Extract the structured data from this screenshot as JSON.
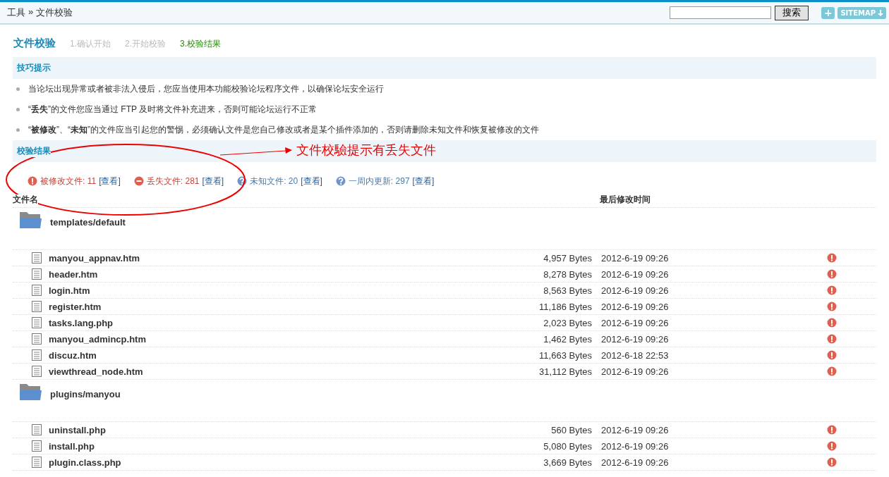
{
  "header": {
    "breadcrumb": [
      "工具",
      "»",
      "文件校验"
    ],
    "search_button": "搜索",
    "plus_button": "+",
    "sitemap_button": "SITEMAP"
  },
  "title": "文件校验",
  "steps": [
    {
      "label": "1.确认开始",
      "selected": false
    },
    {
      "label": "2.开始校验",
      "selected": false
    },
    {
      "label": "3.校验结果",
      "selected": true
    }
  ],
  "tips_heading": "技巧提示",
  "tips": [
    "当论坛出现异常或者被非法入侵后，您应当使用本功能校验论坛程序文件，以确保论坛安全运行",
    "“**丢失**”的文件您应当通过 FTP 及时将文件补充进来，否则可能论坛运行不正常",
    "“**被修改**”、“**未知**”的文件应当引起您的警惕，必须确认文件是您自己修改或者是某个插件添加的，否则请删除未知文件和恢复被修改的文件"
  ],
  "results_heading": "校验结果",
  "annotation": "文件校驗提示有丢失文件",
  "stats": [
    {
      "kind": "modified",
      "label": "被修改文件: 11",
      "link": "[查看]"
    },
    {
      "kind": "missing",
      "label": "丢失文件: 281",
      "link": "[查看]"
    },
    {
      "kind": "unknown",
      "label": "未知文件: 20",
      "link": "[查看]"
    },
    {
      "kind": "unknown",
      "label": "一周内更新: 297",
      "link": "[查看]"
    }
  ],
  "columns": [
    "文件名",
    "最后修改时间"
  ],
  "folders": [
    {
      "name": "templates/default",
      "files": [
        {
          "name": "manyou_appnav.htm",
          "size": "4,957 Bytes",
          "date": "2012-6-19 09:26",
          "kind": "modified"
        },
        {
          "name": "header.htm",
          "size": "8,278 Bytes",
          "date": "2012-6-19 09:26",
          "kind": "modified"
        },
        {
          "name": "login.htm",
          "size": "8,563 Bytes",
          "date": "2012-6-19 09:26",
          "kind": "modified"
        },
        {
          "name": "register.htm",
          "size": "11,186 Bytes",
          "date": "2012-6-19 09:26",
          "kind": "modified"
        },
        {
          "name": "tasks.lang.php",
          "size": "2,023 Bytes",
          "date": "2012-6-19 09:26",
          "kind": "modified"
        },
        {
          "name": "manyou_admincp.htm",
          "size": "1,462 Bytes",
          "date": "2012-6-19 09:26",
          "kind": "modified"
        },
        {
          "name": "discuz.htm",
          "size": "11,663 Bytes",
          "date": "2012-6-18 22:53",
          "kind": "modified"
        },
        {
          "name": "viewthread_node.htm",
          "size": "31,112 Bytes",
          "date": "2012-6-19 09:26",
          "kind": "modified"
        }
      ]
    },
    {
      "name": "plugins/manyou",
      "files": [
        {
          "name": "uninstall.php",
          "size": "560 Bytes",
          "date": "2012-6-19 09:26",
          "kind": "modified"
        },
        {
          "name": "install.php",
          "size": "5,080 Bytes",
          "date": "2012-6-19 09:26",
          "kind": "modified"
        },
        {
          "name": "plugin.class.php",
          "size": "3,669 Bytes",
          "date": "2012-6-19 09:26",
          "kind": "modified"
        }
      ]
    }
  ]
}
